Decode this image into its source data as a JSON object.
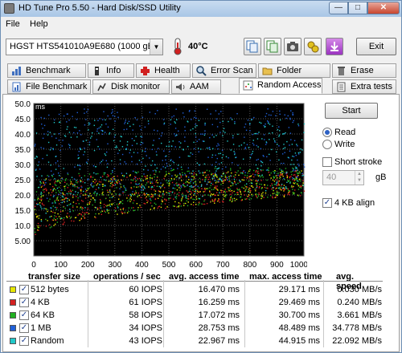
{
  "window": {
    "title": "HD Tune Pro 5.50 - Hard Disk/SSD Utility"
  },
  "menu": {
    "file": "File",
    "help": "Help"
  },
  "toolbar": {
    "drive": "HGST HTS541010A9E680 (1000 gB)",
    "temperature": "40°C",
    "exit_label": "Exit"
  },
  "tabs_row1": [
    "Benchmark",
    "Info",
    "Health",
    "Error Scan",
    "Folder Usage",
    "Erase"
  ],
  "tabs_row2": [
    "File Benchmark",
    "Disk monitor",
    "AAM",
    "Random Access",
    "Extra tests"
  ],
  "active_tab": "Random Access",
  "controls": {
    "start_label": "Start",
    "read_label": "Read",
    "write_label": "Write",
    "mode_selected": "Read",
    "short_stroke_label": "Short stroke",
    "short_stroke_checked": false,
    "short_stroke_value": "40",
    "short_stroke_unit": "gB",
    "align_label": "4 KB align",
    "align_checked": true
  },
  "chart_data": {
    "type": "scatter",
    "ylabel": "ms",
    "xlabel": "gB",
    "xlim": [
      0,
      1000
    ],
    "ylim": [
      0,
      50
    ],
    "xticks": [
      "0",
      "100",
      "200",
      "300",
      "400",
      "500",
      "600",
      "700",
      "800",
      "900",
      "1000gB"
    ],
    "yticks": [
      "5.00",
      "10.0",
      "15.0",
      "20.0",
      "25.0",
      "30.0",
      "35.0",
      "40.0",
      "45.0",
      "50.0"
    ],
    "grid": true,
    "background": "#000000",
    "series": [
      {
        "name": "512 bytes",
        "color": "#e6e600",
        "avg_ms": 16.47,
        "max_ms": 29.171
      },
      {
        "name": "4 KB",
        "color": "#d42020",
        "avg_ms": 16.259,
        "max_ms": 29.469
      },
      {
        "name": "64 KB",
        "color": "#20b020",
        "avg_ms": 17.072,
        "max_ms": 30.7
      },
      {
        "name": "1 MB",
        "color": "#2060d8",
        "avg_ms": 28.753,
        "max_ms": 48.489
      },
      {
        "name": "Random",
        "color": "#20c8c8",
        "avg_ms": 22.967,
        "max_ms": 44.915
      }
    ]
  },
  "table": {
    "headers": [
      "transfer size",
      "operations / sec",
      "avg. access time",
      "max. access time",
      "avg. speed"
    ],
    "rows": [
      {
        "size": "512 bytes",
        "ops": "60 IOPS",
        "avg": "16.470 ms",
        "max": "29.171 ms",
        "speed": "0.030 MB/s",
        "color": "#e6e600"
      },
      {
        "size": "4 KB",
        "ops": "61 IOPS",
        "avg": "16.259 ms",
        "max": "29.469 ms",
        "speed": "0.240 MB/s",
        "color": "#d42020"
      },
      {
        "size": "64 KB",
        "ops": "58 IOPS",
        "avg": "17.072 ms",
        "max": "30.700 ms",
        "speed": "3.661 MB/s",
        "color": "#20b020"
      },
      {
        "size": "1 MB",
        "ops": "34 IOPS",
        "avg": "28.753 ms",
        "max": "48.489 ms",
        "speed": "34.778 MB/s",
        "color": "#2060d8"
      },
      {
        "size": "Random",
        "ops": "43 IOPS",
        "avg": "22.967 ms",
        "max": "44.915 ms",
        "speed": "22.092 MB/s",
        "color": "#20c8c8"
      }
    ]
  }
}
